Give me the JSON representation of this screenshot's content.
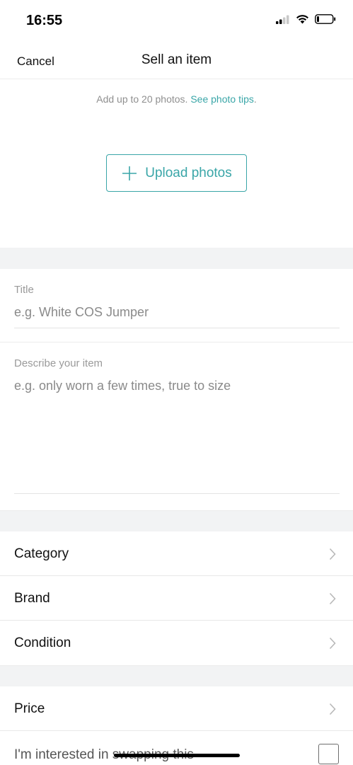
{
  "status_bar": {
    "time": "16:55",
    "icons": [
      "cellular-signal-icon",
      "wifi-icon",
      "battery-icon"
    ]
  },
  "nav": {
    "cancel_label": "Cancel",
    "title": "Sell an item"
  },
  "photos": {
    "hint_text": "Add up to 20 photos. ",
    "tips_link": "See photo tips",
    "tips_suffix": ".",
    "upload_label": "Upload photos",
    "upload_icon": "plus-icon"
  },
  "title_field": {
    "label": "Title",
    "placeholder": "e.g. White COS Jumper"
  },
  "description_field": {
    "label": "Describe your item",
    "placeholder": "e.g. only worn a few times, true to size"
  },
  "details": {
    "rows": [
      {
        "label": "Category"
      },
      {
        "label": "Brand"
      },
      {
        "label": "Condition"
      }
    ]
  },
  "pricing": {
    "price_label": "Price",
    "swap_label": "I'm interested in swapping this",
    "swap_checked": false
  },
  "colors": {
    "accent": "#3aa6a8",
    "section_gap": "#f2f3f4",
    "placeholder": "#8a8a8a"
  }
}
